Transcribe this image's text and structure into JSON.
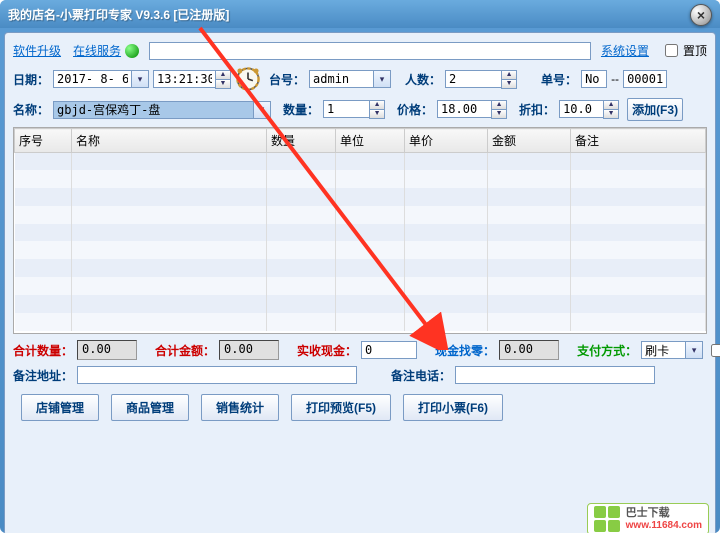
{
  "window": {
    "title": "我的店名-小票打印专家 V9.3.6 [已注册版]"
  },
  "toolbar": {
    "upgrade": "软件升级",
    "online_service": "在线服务",
    "system_settings": "系统设置",
    "pin_top": "置顶"
  },
  "form": {
    "date_label": "日期：",
    "date_value": "2017- 8- 6",
    "time_value": "13:21:30",
    "desk_label": "台号：",
    "desk_value": "admin",
    "people_label": "人数：",
    "people_value": "2",
    "order_label": "单号：",
    "order_prefix": "No",
    "order_dashes": "--",
    "order_value": "00001",
    "name_label": "名称：",
    "name_value": "gbjd-宫保鸡丁-盘",
    "qty_label": "数量：",
    "qty_value": "1",
    "price_label": "价格：",
    "price_value": "18.00",
    "discount_label": "折扣：",
    "discount_value": "10.0",
    "add_btn": "添加(F3)"
  },
  "table": {
    "headers": [
      "序号",
      "名称",
      "数量",
      "单位",
      "单价",
      "金额",
      "备注"
    ]
  },
  "totals": {
    "total_qty_label": "合计数量：",
    "total_qty_value": "0.00",
    "total_amount_label": "合计金额：",
    "total_amount_value": "0.00",
    "cash_received_label": "实收现金：",
    "cash_received_value": "0",
    "change_label": "现金找零：",
    "change_value": "0.00",
    "pay_method_label": "支付方式：",
    "pay_method_value": "刷卡"
  },
  "remarks": {
    "address_label": "备注地址：",
    "address_value": "",
    "phone_label": "备注电话：",
    "phone_value": ""
  },
  "buttons": {
    "shop_mgmt": "店铺管理",
    "product_mgmt": "商品管理",
    "sales_stats": "销售统计",
    "print_preview": "打印预览(F5)",
    "print_receipt": "打印小票(F6)"
  },
  "watermark": {
    "brand": "巴士下载",
    "url": "www.11684.com"
  }
}
